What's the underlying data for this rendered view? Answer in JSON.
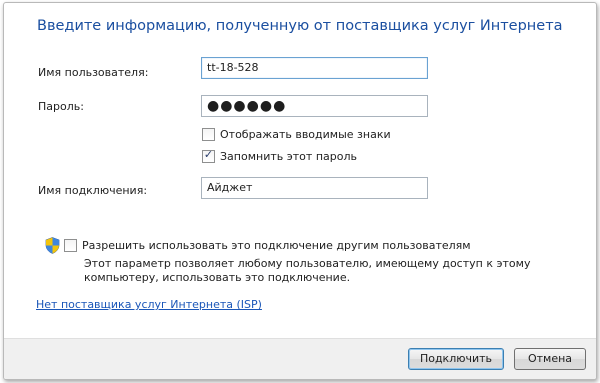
{
  "dialog": {
    "heading": "Введите информацию, полученную от поставщика услуг Интернета"
  },
  "form": {
    "username_label": "Имя пользователя:",
    "username_value": "tt-18-528",
    "password_label": "Пароль:",
    "password_value": "●●●●●●",
    "show_chars_label": "Отображать вводимые знаки",
    "show_chars_checked": false,
    "remember_label": "Запомнить этот пароль",
    "remember_checked": true,
    "connection_label": "Имя подключения:",
    "connection_value": "Айджет"
  },
  "sharing": {
    "allow_label": "Разрешить использовать это подключение другим пользователям",
    "allow_checked": false,
    "description": "Этот параметр позволяет любому пользователю, имеющему доступ к этому компьютеру, использовать это подключение.",
    "shield_icon": "uac-shield-icon"
  },
  "link": {
    "no_isp": "Нет поставщика услуг Интернета (ISP)"
  },
  "buttons": {
    "connect": "Подключить",
    "cancel": "Отмена"
  },
  "colors": {
    "heading": "#1b4fa0",
    "link": "#1a56b8",
    "footer_bg": "#f0f0f0"
  }
}
